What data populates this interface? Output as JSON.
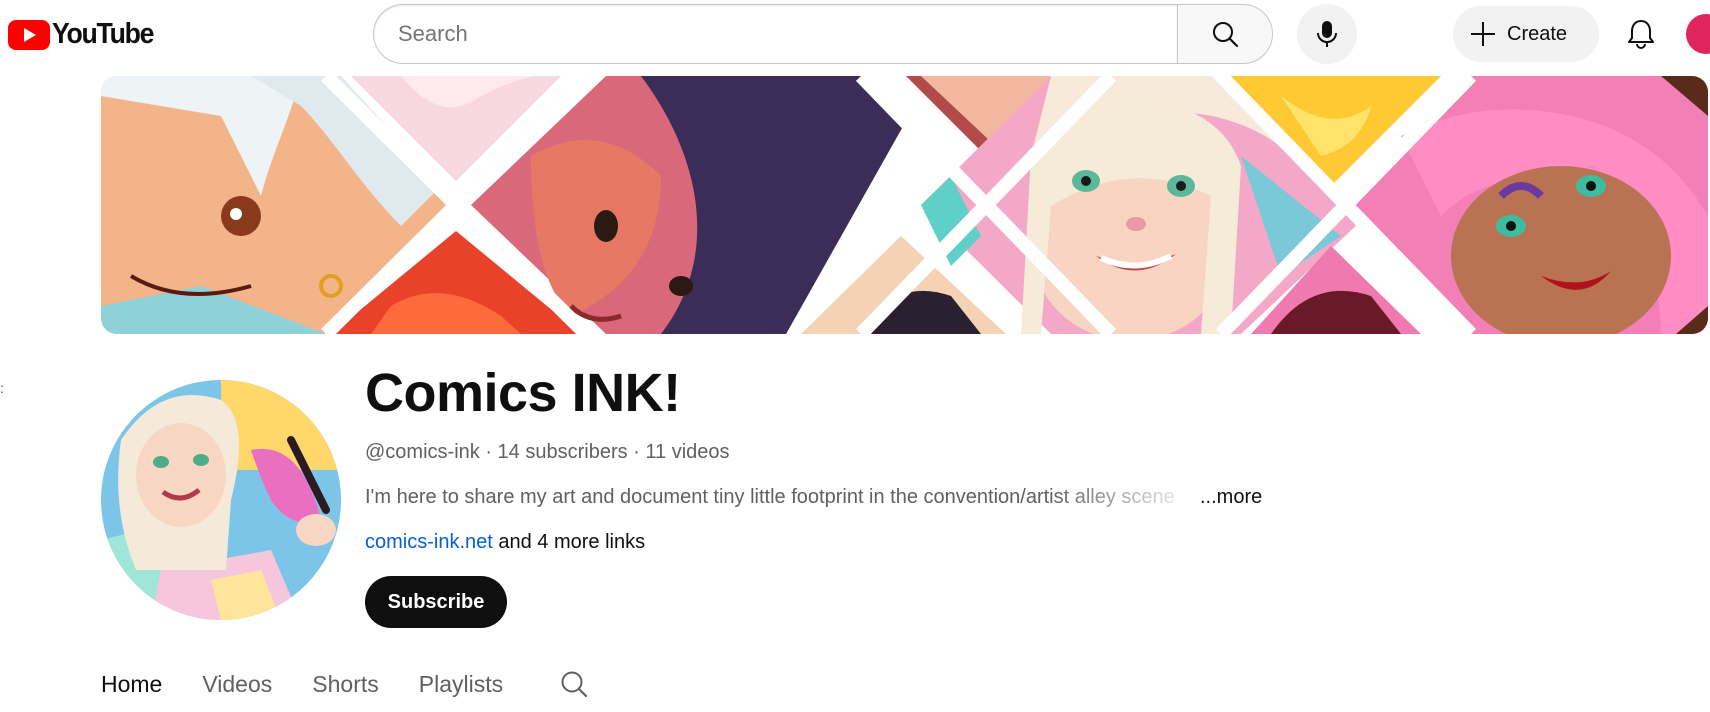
{
  "app": {
    "logo_text": "YouTube",
    "brand_color": "#ff0000"
  },
  "search": {
    "placeholder": "Search",
    "value": ""
  },
  "header": {
    "create_label": "Create",
    "icons": [
      "search-icon",
      "mic-icon",
      "plus-icon",
      "bell-icon"
    ]
  },
  "channel": {
    "name": "Comics INK!",
    "handle": "@comics-ink",
    "separator": " · ",
    "subscribers": "14 subscribers",
    "videos": "11 videos",
    "description": "I'm here to share my art and document tiny little footprint in the convention/artist alley scene",
    "description_more": "...more",
    "link": "comics-ink.net",
    "more_links": " and 4 more links",
    "subscribe_label": "Subscribe"
  },
  "tabs": [
    {
      "label": "Home",
      "active": true
    },
    {
      "label": "Videos",
      "active": false
    },
    {
      "label": "Shorts",
      "active": false
    },
    {
      "label": "Playlists",
      "active": false
    }
  ],
  "colors": {
    "link": "#065fd4",
    "text_secondary": "#606060",
    "subscribe_bg": "#0f0f0f"
  }
}
